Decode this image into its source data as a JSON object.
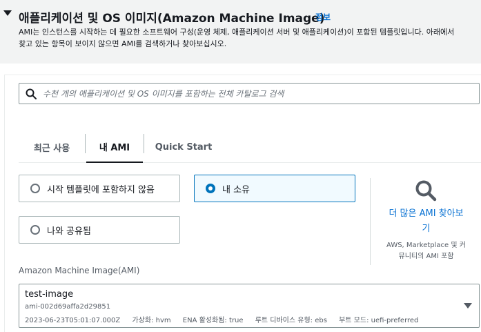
{
  "header": {
    "title": "애플리케이션 및 OS 이미지(Amazon Machine Image)",
    "info_link": "정보",
    "description_line1": "AMI는 인스턴스를 시작하는 데 필요한 소프트웨어 구성(운영 체제, 애플리케이션 서버 및 애플리케이션)이 포함된 템플릿입니다. 아래에서",
    "description_line2": "찾고 있는 항목이 보이지 않으면 AMI를 검색하거나 찾아보십시오."
  },
  "search": {
    "placeholder": "수천 개의 애플리케이션 및 OS 이미지를 포함하는 전체 카탈로그 검색",
    "value": ""
  },
  "tabs": [
    {
      "label": "최근 사용",
      "active": false
    },
    {
      "label": "내 AMI",
      "active": true
    },
    {
      "label": "Quick Start",
      "active": false
    }
  ],
  "options": {
    "launch_template": {
      "label": "시작 템플릿에 포함하지 않음",
      "selected": false
    },
    "owned_by_me": {
      "label": "내 소유",
      "selected": true
    },
    "shared_with_me": {
      "label": "나와 공유됨",
      "selected": false
    }
  },
  "find_more": {
    "icon": "search-icon",
    "link_line1": "더 많은 AMI 찾아보",
    "link_line2": "기",
    "desc_line1": "AWS, Marketplace 및 커",
    "desc_line2": "뮤니티의 AMI 포함"
  },
  "ami_select": {
    "label": "Amazon Machine Image(AMI)",
    "name": "test-image",
    "id": "ami-002d69affa2d29851",
    "created": "2023-06-23T05:01:07.000Z",
    "virtualization": "가상화: hvm",
    "ena": "ENA 활성화됨: true",
    "root_device": "루트 디바이스 유형: ebs",
    "boot_mode": "부트 모드: uefi-preferred"
  },
  "colors": {
    "accent": "#0073bb",
    "link": "#0972d3",
    "header_bg": "#f2f3f3",
    "selected_bg": "#f1faff"
  }
}
